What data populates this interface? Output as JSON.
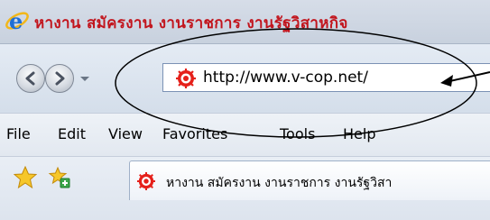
{
  "window": {
    "title": "หางาน สมัครงาน งานราชการ งานรัฐวิสาหกิจ",
    "app_icon": "ie-icon",
    "accent_color": "#c2151d"
  },
  "navigation": {
    "back_icon": "back-arrow-icon",
    "forward_icon": "forward-arrow-icon",
    "history_icon": "dropdown-arrow-icon"
  },
  "address_bar": {
    "site_icon": "site-favicon",
    "url": "http://www.v-cop.net/"
  },
  "menu": {
    "items": [
      "File",
      "Edit",
      "View",
      "Favorites",
      "Tools",
      "Help"
    ]
  },
  "favorites_bar": {
    "favorites_icon": "star-icon",
    "add_favorite_icon": "add-favorite-icon",
    "tab_title": "หางาน สมัครงาน งานราชการ งานรัฐวิสา"
  },
  "annotation": {
    "shape": "ellipse",
    "pointer": "arrow",
    "color": "#000000"
  }
}
